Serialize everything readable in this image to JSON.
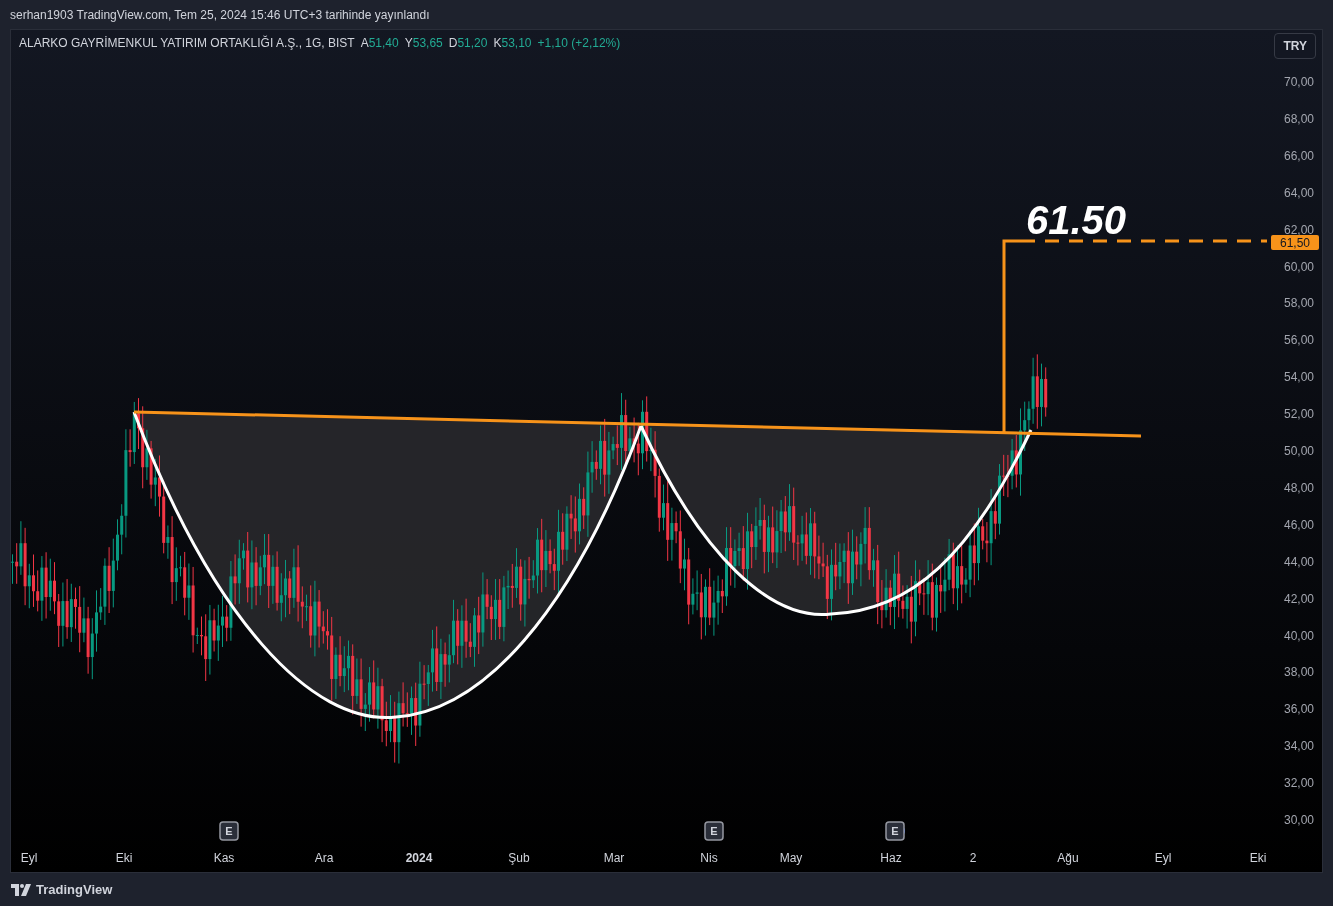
{
  "header": {
    "text": "serhan1903 TradingView.com, Tem 25, 2024 15:46 UTC+3 tarihinde yayınlandı"
  },
  "legend": {
    "symbol": "ALARKO GAYRİMENKUL YATIRIM ORTAKLIĞI A.Ş., 1G, BIST",
    "values": [
      {
        "label": "A",
        "value": "51,40"
      },
      {
        "label": "Y",
        "value": "53,65"
      },
      {
        "label": "D",
        "value": "51,20"
      },
      {
        "label": "K",
        "value": "53,10"
      }
    ],
    "change": "+1,10 (+2,12%)"
  },
  "currency_button": "TRY",
  "chart": {
    "y_axis": [
      "70,00",
      "68,00",
      "66,00",
      "64,00",
      "62,00",
      "60,00",
      "58,00",
      "56,00",
      "54,00",
      "52,00",
      "50,00",
      "48,00",
      "46,00",
      "44,00",
      "42,00",
      "40,00",
      "38,00",
      "36,00",
      "34,00",
      "32,00",
      "30,00"
    ],
    "x_axis": [
      {
        "label": "Eyl",
        "kind": "month"
      },
      {
        "label": "Eki",
        "kind": "month"
      },
      {
        "label": "Kas",
        "kind": "month"
      },
      {
        "label": "Ara",
        "kind": "month"
      },
      {
        "label": "2024",
        "kind": "year"
      },
      {
        "label": "Şub",
        "kind": "month"
      },
      {
        "label": "Mar",
        "kind": "month"
      },
      {
        "label": "Nis",
        "kind": "month"
      },
      {
        "label": "May",
        "kind": "month"
      },
      {
        "label": "Haz",
        "kind": "month"
      },
      {
        "label": "2",
        "kind": "month"
      },
      {
        "label": "Ağu",
        "kind": "month"
      },
      {
        "label": "Eyl",
        "kind": "month"
      },
      {
        "label": "Eki",
        "kind": "month"
      }
    ],
    "target_label": "61.50",
    "price_tag": "61,50",
    "earnings_markers": [
      "E",
      "E",
      "E"
    ]
  },
  "footer": {
    "brand": "TradingView"
  }
}
